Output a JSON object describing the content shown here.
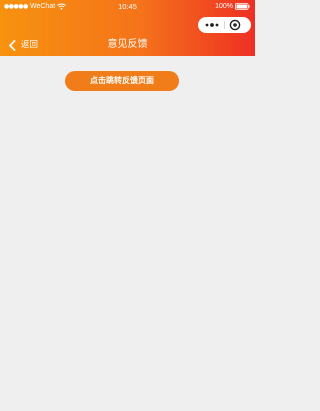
{
  "status_bar": {
    "signal": "●●●●●",
    "carrier": "WeChat",
    "time": "10:45",
    "battery_percent": "100%"
  },
  "nav": {
    "back_label": "返回",
    "title": "意见反馈"
  },
  "main": {
    "feedback_button_label": "点击跳转反馈页面"
  },
  "colors": {
    "header_gradient_start": "#f7920f",
    "header_gradient_end": "#ee2f24",
    "button": "#f07c1a",
    "background": "#efefef"
  },
  "icons": [
    "wifi-icon",
    "battery-icon",
    "more-icon",
    "close-circle-icon",
    "back-icon"
  ]
}
